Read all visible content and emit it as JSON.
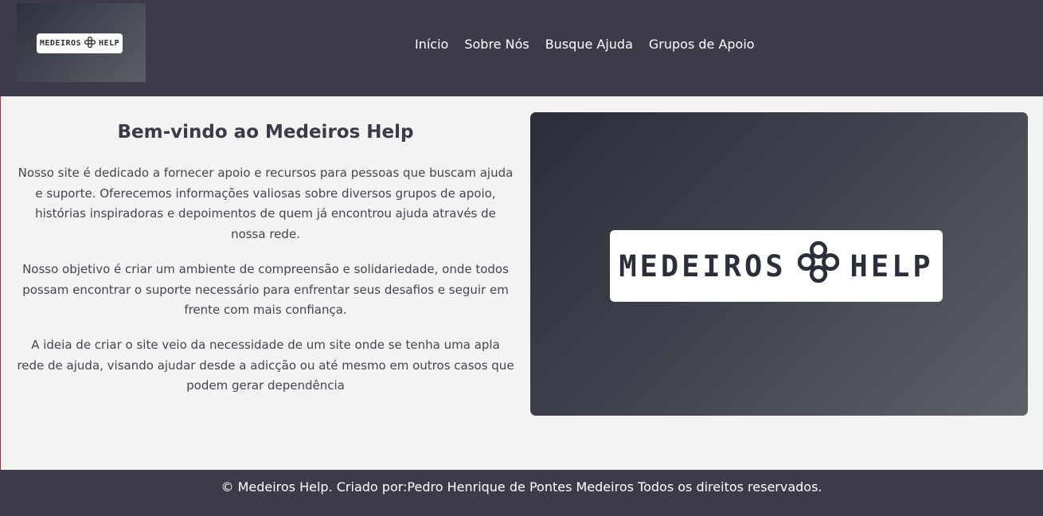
{
  "header": {
    "logo": {
      "text_left": "MEDEIROS",
      "icon": "celtic-knot-icon",
      "text_right": "HELP"
    },
    "nav": [
      "Início",
      "Sobre Nós",
      "Busque Ajuda",
      "Grupos de Apoio"
    ]
  },
  "main": {
    "title": "Bem-vindo ao Medeiros Help",
    "paragraphs": [
      "Nosso site é dedicado a fornecer apoio e recursos para pessoas que buscam ajuda e suporte. Oferecemos informações valiosas sobre diversos grupos de apoio, histórias inspiradoras e depoimentos de quem já encontrou ajuda através de nossa rede.",
      "Nosso objetivo é criar um ambiente de compreensão e solidariedade, onde todos possam encontrar o suporte necessário para enfrentar seus desafios e seguir em frente com mais confiança.",
      "A ideia de criar o site veio da necessidade de um site onde se tenha uma apla rede de ajuda, visando ajudar desde a adicção ou até mesmo em outros casos que podem gerar dependência"
    ],
    "hero_logo": {
      "text_left": "MEDEIROS",
      "icon": "celtic-knot-icon",
      "text_right": "HELP"
    }
  },
  "footer": {
    "text": "© Medeiros Help. Criado por:Pedro Henrique de Pontes Medeiros Todos os direitos reservados."
  },
  "colors": {
    "header_bg": "#3d3b4a",
    "main_bg": "#f3f3f3",
    "footer_bg": "#3d3b4a",
    "text": "#3a3a48",
    "edge_accent": "#b8283e"
  }
}
